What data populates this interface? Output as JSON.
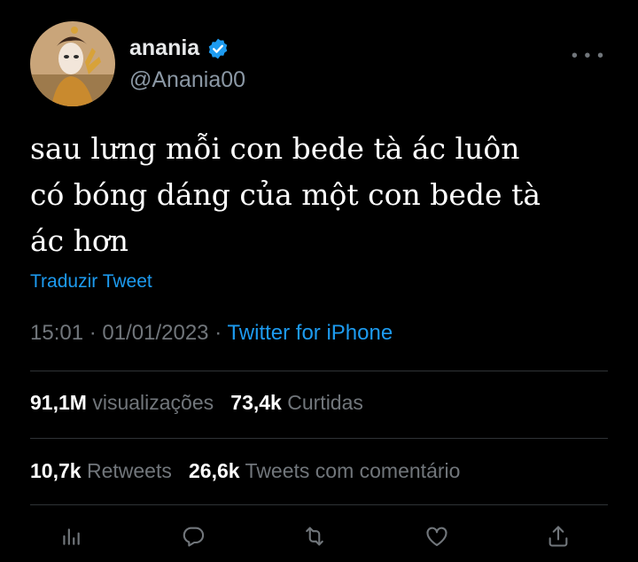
{
  "author": {
    "name": "anania",
    "handle": "@Anania00",
    "verified": true
  },
  "tweet": {
    "text": "sau lưng mỗi con bede tà ác luôn\ncó bóng dáng của một con bede tà\nác hơn",
    "translate_label": "Traduzir Tweet",
    "time": "15:01",
    "separator": "·",
    "date": "01/01/2023",
    "source": "Twitter for iPhone"
  },
  "stats": {
    "views_count": "91,1M",
    "views_label": "visualizações",
    "likes_count": "73,4k",
    "likes_label": "Curtidas",
    "retweets_count": "10,7k",
    "retweets_label": "Retweets",
    "quotes_count": "26,6k",
    "quotes_label": "Tweets com comentário"
  },
  "actions": [
    "analytics-icon",
    "reply-icon",
    "retweet-icon",
    "like-icon",
    "share-icon"
  ],
  "colors": {
    "background": "#000000",
    "accent": "#1d9bf0",
    "muted": "#71767b",
    "divider": "#2f3336"
  }
}
